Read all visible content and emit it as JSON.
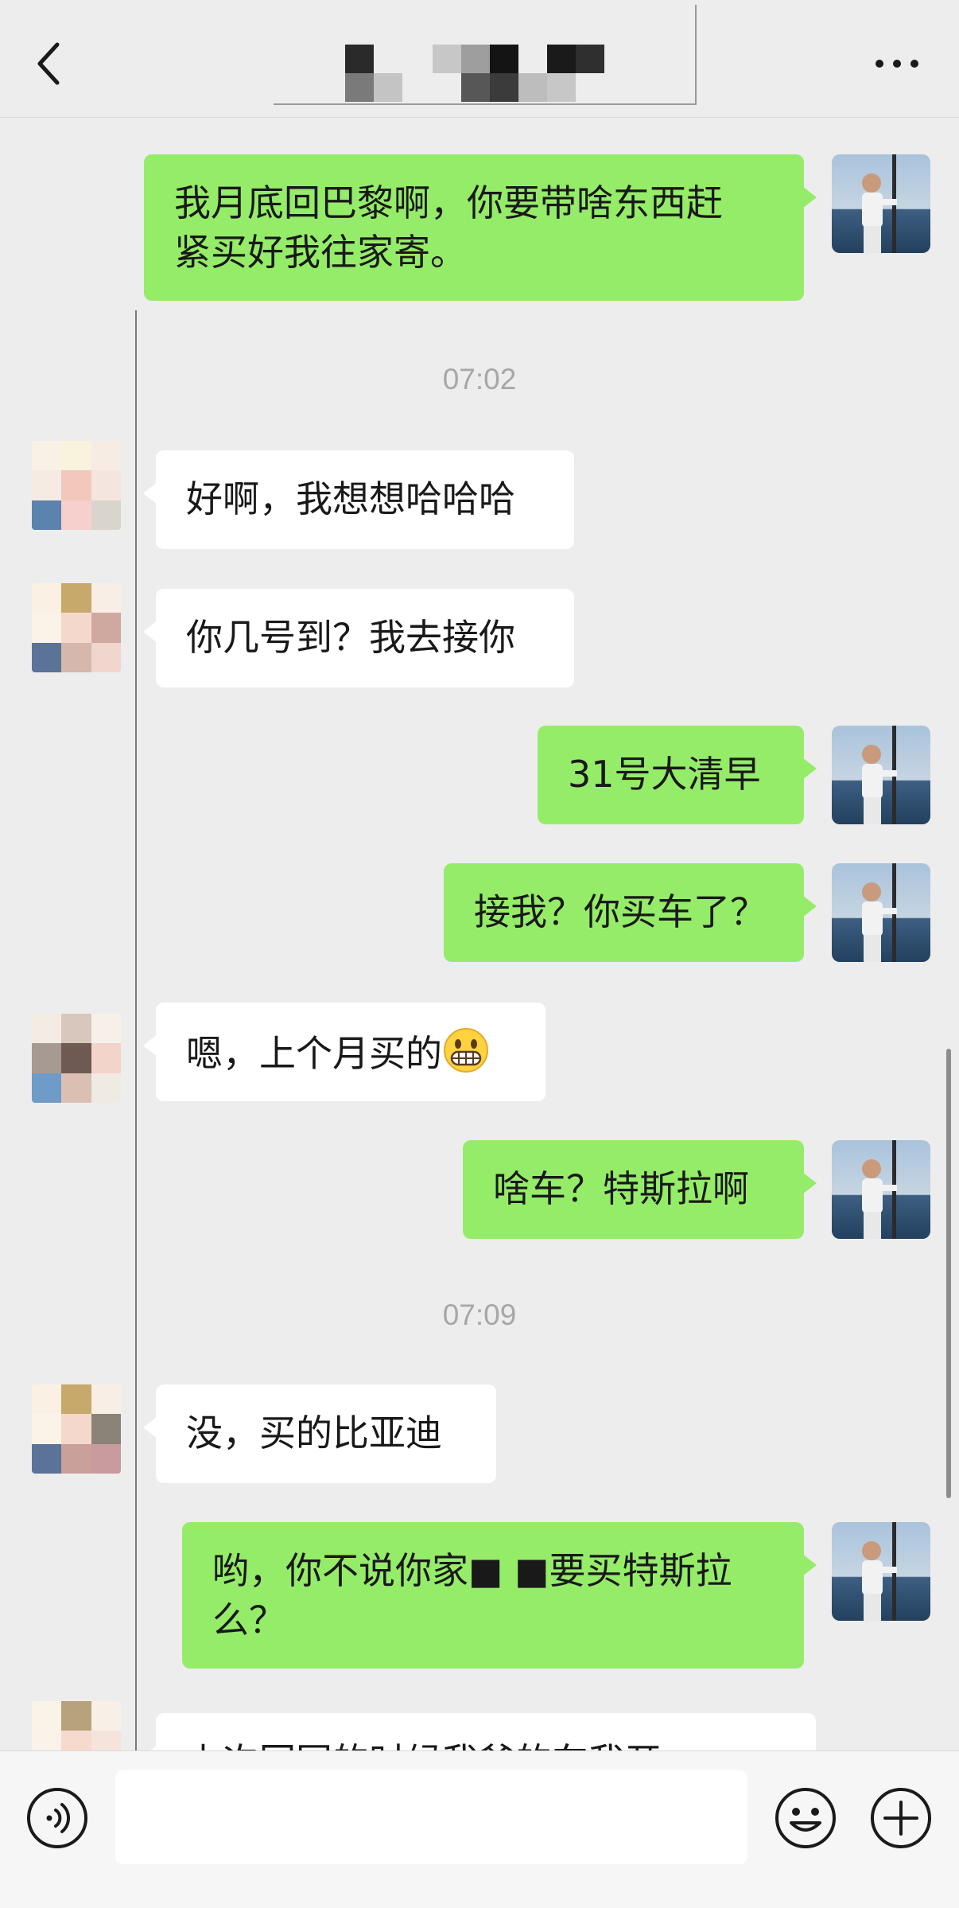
{
  "header": {
    "title": "",
    "back_icon": "chevron-left-icon",
    "more_icon": "ellipsis-icon"
  },
  "messages": [
    {
      "sender": "me",
      "text": "我月底回巴黎啊，你要带啥东西赶\n紧买好我往家寄。"
    },
    {
      "sender": "friend",
      "text": "好啊，我想想哈哈哈"
    },
    {
      "sender": "friend",
      "text": "你几号到？我去接你"
    },
    {
      "sender": "me",
      "text": "31号大清早"
    },
    {
      "sender": "me",
      "text": "接我？你买车了？"
    },
    {
      "sender": "friend",
      "text": "嗯，上个月买的",
      "emoji": "grinning-face-emoji"
    },
    {
      "sender": "me",
      "text": "啥车？特斯拉啊"
    },
    {
      "sender": "friend",
      "text": "没，买的比亚迪"
    },
    {
      "sender": "me",
      "text": "哟，你不说你家■ ■要买特斯拉\n么？"
    },
    {
      "sender": "friend",
      "text": "上次回国的时候我爸的车我开"
    }
  ],
  "timestamps": [
    "07:02",
    "07:09"
  ],
  "input_bar": {
    "voice_icon": "voice-icon",
    "emoji_icon": "smiley-icon",
    "plus_icon": "plus-circle-icon",
    "input_value": ""
  },
  "colors": {
    "background": "#ededed",
    "my_bubble": "#95ec69",
    "friend_bubble": "#ffffff",
    "timestamp_text": "#a7a7a7"
  }
}
